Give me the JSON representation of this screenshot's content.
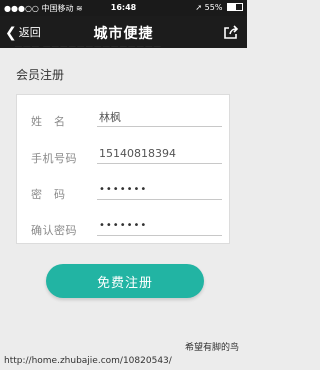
{
  "status_bar": {
    "carrier": "中国移动",
    "time": "16:48",
    "battery": "55%",
    "battery_level": 0.55
  },
  "nav": {
    "back_label": "返回",
    "title": "城市便捷",
    "back_icon": "chevron-left-icon",
    "share_icon": "share-icon"
  },
  "section_title": "会员注册",
  "form": {
    "fields": [
      {
        "label": "姓　名",
        "value": "林枫",
        "type": "text"
      },
      {
        "label": "手机号码",
        "value": "15140818394",
        "type": "text"
      },
      {
        "label": "密　码",
        "value": "•••••••",
        "type": "password"
      },
      {
        "label": "确认密码",
        "value": "•••••••",
        "type": "password"
      }
    ]
  },
  "register_button_label": "免费注册",
  "watermark": {
    "name": "希望有脚的鸟",
    "url": "http://home.zhubajie.com/10820543/"
  },
  "colors": {
    "accent": "#22b4a3",
    "navbar": "#1c1c1c",
    "background": "#ececec"
  }
}
